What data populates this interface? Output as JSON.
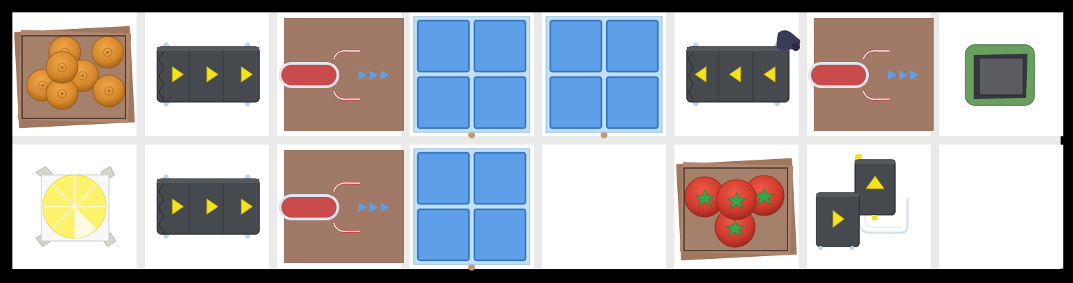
{
  "colors": {
    "background": "#000000",
    "tile": "#ffffff",
    "grid_gap": "#eaeaea",
    "conveyor_body": "#46494d",
    "conveyor_arrow": "#f2e21c",
    "dispenser_base": "#a07a66",
    "dispenser_slot": "#c94b4b",
    "counter_blue": "#5d9fe8",
    "counter_frame": "#bfe0f6",
    "tomato": "#d63a2c",
    "onion": "#d68a2c",
    "trash_green": "#6aa05f",
    "cutting_board": "#fff36b"
  },
  "grid": {
    "rows": [
      [
        {
          "tile": "onion-crate",
          "icon": "onion-crate-icon"
        },
        {
          "tile": "conveyor",
          "direction": "right",
          "icon": "conveyor-right-icon"
        },
        {
          "tile": "plate-dispenser",
          "direction": "right",
          "icon": "dispenser-icon"
        },
        {
          "tile": "counter",
          "icon": "counter-icon"
        },
        {
          "tile": "counter",
          "icon": "counter-icon"
        },
        {
          "tile": "conveyor",
          "direction": "left",
          "icon": "conveyor-left-icon",
          "extra": "chef-hat"
        },
        {
          "tile": "plate-dispenser",
          "direction": "right",
          "icon": "dispenser-icon"
        },
        {
          "tile": "trash",
          "icon": "trash-bin-icon"
        }
      ],
      [
        {
          "tile": "cutting-board",
          "icon": "cutting-board-icon"
        },
        {
          "tile": "conveyor",
          "direction": "right",
          "icon": "conveyor-right-icon"
        },
        {
          "tile": "plate-dispenser",
          "direction": "right",
          "icon": "dispenser-icon"
        },
        {
          "tile": "counter",
          "icon": "counter-icon"
        },
        {
          "tile": "floor",
          "icon": ""
        },
        {
          "tile": "tomato-crate",
          "icon": "tomato-crate-icon"
        },
        {
          "tile": "conveyor-junction",
          "direction": "up-right",
          "icon": "conveyor-junction-icon"
        },
        {
          "tile": "floor",
          "icon": ""
        }
      ]
    ]
  }
}
